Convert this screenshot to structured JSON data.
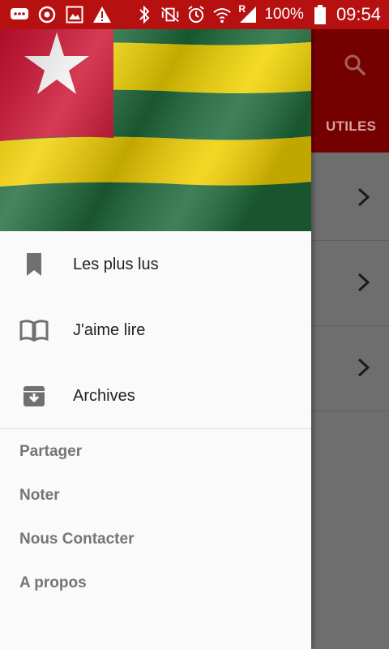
{
  "status_bar": {
    "battery": "100%",
    "time": "09:54",
    "signal_label": "R"
  },
  "underlying": {
    "tab_label": "UTILES"
  },
  "drawer": {
    "header_image": "togo-flag",
    "nav_items": [
      {
        "label": "Les plus lus",
        "icon": "bookmark-icon"
      },
      {
        "label": "J'aime lire",
        "icon": "book-open-icon"
      },
      {
        "label": "Archives",
        "icon": "archive-icon"
      }
    ],
    "secondary_items": [
      {
        "label": "Partager"
      },
      {
        "label": "Noter"
      },
      {
        "label": "Nous Contacter"
      },
      {
        "label": "A propos"
      }
    ]
  },
  "colors": {
    "status_bar": "#b71010",
    "toolbar": "#750000",
    "flag_red": "#d21034",
    "flag_yellow": "#ffce00",
    "flag_green": "#006a4e"
  }
}
